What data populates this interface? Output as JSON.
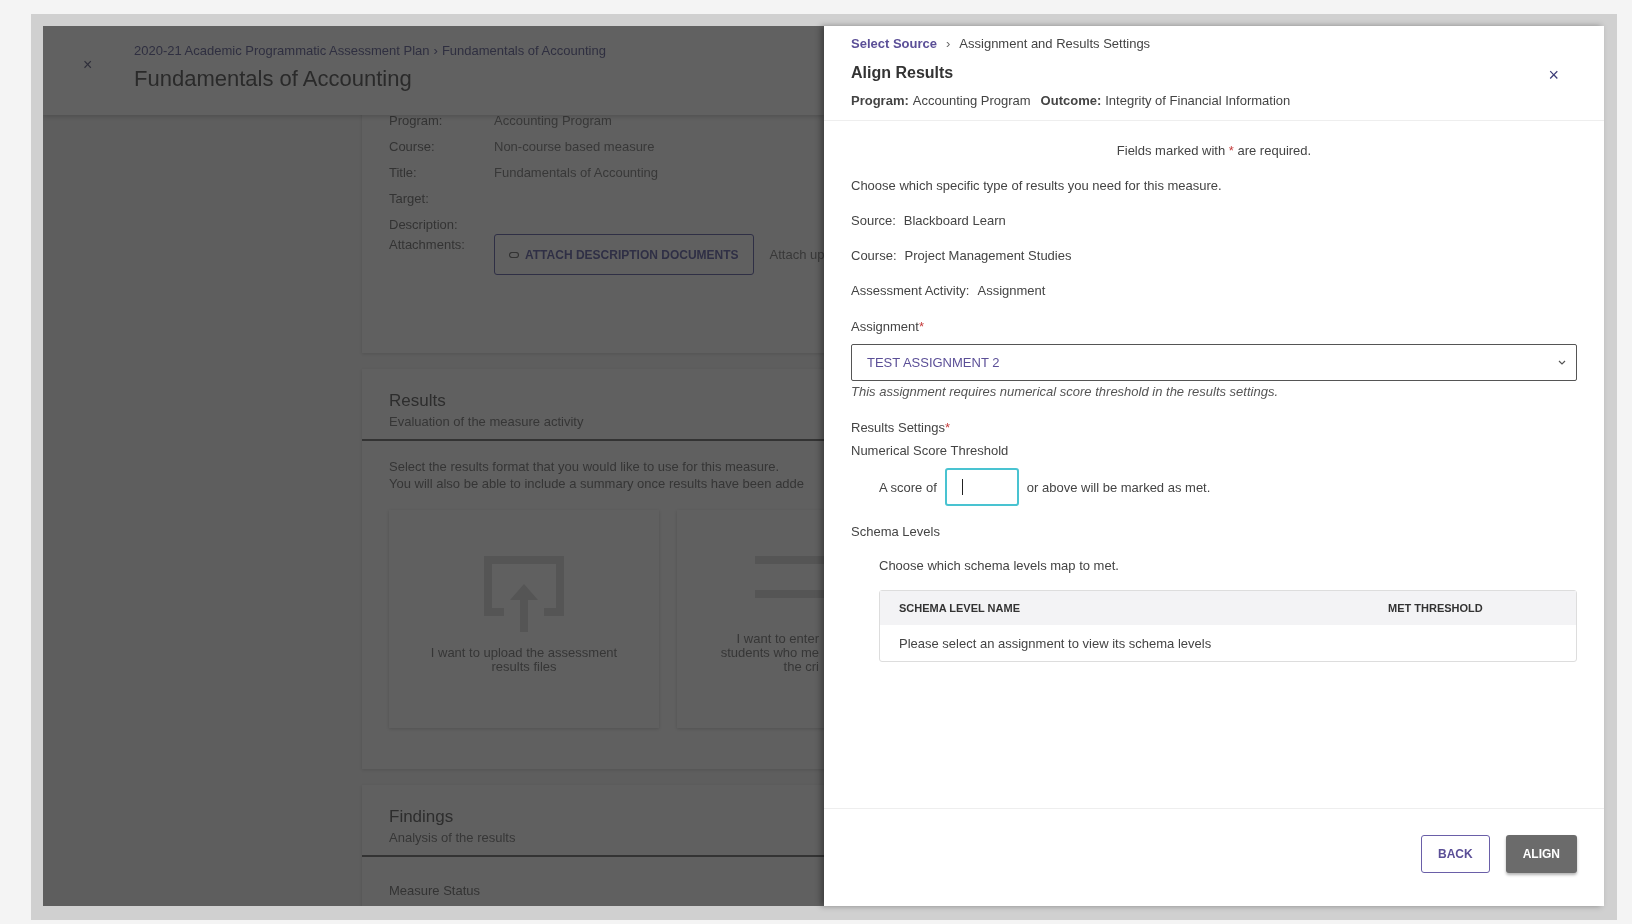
{
  "background": {
    "close": "×",
    "breadcrumb": {
      "parent": "2020-21 Academic Programmatic Assessment Plan",
      "separator": "›",
      "current": "Fundamentals of Accounting"
    },
    "title": "Fundamentals of Accounting",
    "details": [
      {
        "label": "Program:",
        "value": "Accounting Program"
      },
      {
        "label": "Course:",
        "value": "Non-course based measure"
      },
      {
        "label": "Title:",
        "value": "Fundamentals of Accounting"
      },
      {
        "label": "Target:"
      },
      {
        "label": "Description:"
      }
    ],
    "attachments": {
      "label": "Attachments:",
      "button": "ATTACH DESCRIPTION DOCUMENTS",
      "note": "Attach up"
    },
    "results": {
      "title": "Results",
      "subtitle": "Evaluation of the measure activity",
      "intro": [
        "Select the results format that you would like to use for this measure.",
        "You will also be able to include a summary once results have been adde"
      ],
      "options": [
        {
          "kind": "upload",
          "text": "I want to upload the assessment results files"
        },
        {
          "kind": "list",
          "text": "I want to enter\nstudents who me\nthe cri"
        }
      ]
    },
    "findings": {
      "title": "Findings",
      "subtitle": "Analysis of the results"
    },
    "measure_status": "Measure Status"
  },
  "panel": {
    "breadcrumb": [
      {
        "label": "Select Source",
        "kind": "link"
      },
      {
        "label": "Assignment and Results Settings",
        "kind": "current"
      }
    ],
    "breadcrumb_separator": "›",
    "title": "Align Results",
    "close": "×",
    "meta": [
      {
        "label": "Program:",
        "value": "Accounting Program"
      },
      {
        "label": "Outcome:",
        "value": "Integrity of Financial Information"
      }
    ],
    "required_note": {
      "before": "Fields marked with",
      "mark": "*",
      "after": "are required."
    },
    "intro": "Choose which specific type of results you need for this measure.",
    "info": [
      {
        "label": "Source:",
        "value": "Blackboard Learn"
      },
      {
        "label": "Course:",
        "value": "Project Management Studies"
      },
      {
        "label": "Assessment Activity:",
        "value": "Assignment"
      }
    ],
    "assignment": {
      "label": "Assignment",
      "mark": "*",
      "value": "TEST ASSIGNMENT 2",
      "hint": "This assignment requires numerical score threshold in the results settings."
    },
    "results_settings": {
      "label": "Results Settings",
      "mark": "*",
      "type": "Numerical Score Threshold",
      "score_before": "A score of",
      "score_after": "or above will be marked as met.",
      "focused": true
    },
    "schema": {
      "label": "Schema Levels",
      "instruction": "Choose which schema levels map to met.",
      "columns": [
        "SCHEMA LEVEL NAME",
        "MET THRESHOLD"
      ],
      "empty": "Please select an assignment to view its schema levels"
    },
    "buttons": [
      {
        "label": "BACK",
        "kind": "secondary"
      },
      {
        "label": "ALIGN",
        "kind": "primary"
      }
    ]
  }
}
